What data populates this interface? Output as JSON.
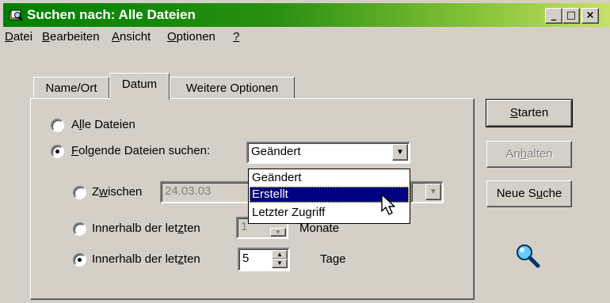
{
  "window": {
    "title": "Suchen nach: Alle Dateien"
  },
  "titlebar_buttons": {
    "minimize": "_",
    "maximize": "□",
    "close": "×"
  },
  "menu": {
    "items": [
      {
        "pre": "",
        "key": "D",
        "post": "atei"
      },
      {
        "pre": "",
        "key": "B",
        "post": "earbeiten"
      },
      {
        "pre": "",
        "key": "A",
        "post": "nsicht"
      },
      {
        "pre": "",
        "key": "O",
        "post": "ptionen"
      },
      {
        "pre": "",
        "key": "?",
        "post": ""
      }
    ]
  },
  "tabs": [
    "Name/Ort",
    "Datum",
    "Weitere Optionen"
  ],
  "options": {
    "all_files": {
      "pre": "A",
      "key": "l",
      "post": "le Dateien"
    },
    "search_following": {
      "pre": "",
      "key": "F",
      "post": "olgende Dateien suchen:"
    },
    "between": {
      "pre": "Z",
      "key": "w",
      "post": "ischen",
      "date_from": "24.03.03"
    },
    "within_months": {
      "pre": "Innerhalb der let",
      "key": "z",
      "post": "ten",
      "value": "1",
      "unit": "Monate"
    },
    "within_days": {
      "pre": "Innerhalb der let",
      "key": "z",
      "post": "ten",
      "value": "5",
      "unit": "Tage"
    }
  },
  "date_type_select": {
    "value": "Geändert",
    "dropdown_options": [
      "Geändert",
      "Erstellt",
      "Letzter Zugriff"
    ],
    "selected_option": "Erstellt"
  },
  "buttons": {
    "start": {
      "pre": "",
      "key": "S",
      "post": "tarten"
    },
    "stop": {
      "pre": "An",
      "key": "h",
      "post": "alten"
    },
    "new_search": {
      "pre": "Neue S",
      "key": "u",
      "post": "che"
    }
  },
  "icons": {
    "search": "magnifier-icon",
    "app": "find-files-icon",
    "cursor": "mouse-pointer-icon"
  }
}
